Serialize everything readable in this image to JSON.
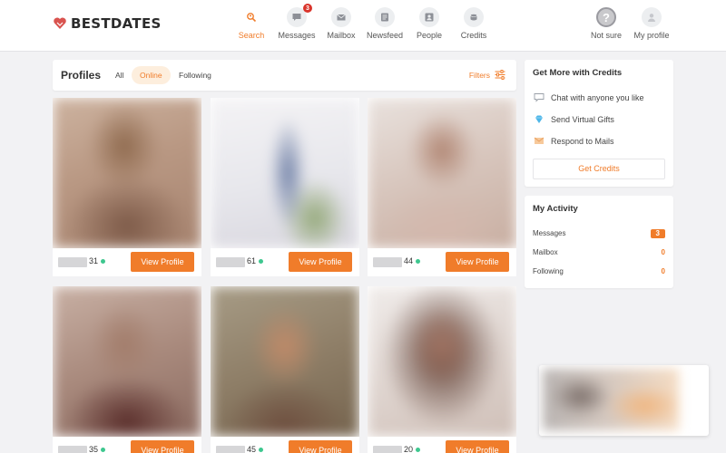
{
  "brand": {
    "name": "BESTDATES"
  },
  "nav": {
    "items": [
      {
        "label": "Search",
        "icon": "search-icon",
        "active": true
      },
      {
        "label": "Messages",
        "icon": "chat-icon",
        "badge": "3"
      },
      {
        "label": "Mailbox",
        "icon": "mail-icon"
      },
      {
        "label": "Newsfeed",
        "icon": "newsfeed-icon"
      },
      {
        "label": "People",
        "icon": "people-icon"
      },
      {
        "label": "Credits",
        "icon": "credits-icon"
      }
    ],
    "not_sure": "Not sure",
    "my_profile": "My profile"
  },
  "profiles": {
    "title": "Profiles",
    "tabs": [
      "All",
      "Online",
      "Following"
    ],
    "active_tab": "Online",
    "filters_label": "Filters",
    "cards": [
      {
        "age": "31",
        "online": true,
        "button": "View Profile"
      },
      {
        "age": "61",
        "online": true,
        "button": "View Profile"
      },
      {
        "age": "44",
        "online": true,
        "button": "View Profile"
      },
      {
        "age": "35",
        "online": true,
        "button": "View Profile"
      },
      {
        "age": "45",
        "online": true,
        "button": "View Profile"
      },
      {
        "age": "20",
        "online": true,
        "button": "View Profile"
      }
    ]
  },
  "credits_panel": {
    "title": "Get More with Credits",
    "items": [
      {
        "label": "Chat with anyone you like",
        "icon": "chat-bubble-icon"
      },
      {
        "label": "Send Virtual Gifts",
        "icon": "gem-icon"
      },
      {
        "label": "Respond to Mails",
        "icon": "envelope-icon"
      }
    ],
    "button": "Get Credits"
  },
  "activity": {
    "title": "My Activity",
    "rows": [
      {
        "label": "Messages",
        "value": "3"
      },
      {
        "label": "Mailbox",
        "value": "0"
      },
      {
        "label": "Following",
        "value": "0"
      }
    ]
  },
  "colors": {
    "accent": "#f07c2a",
    "online": "#3ec78f",
    "badge": "#d9342b",
    "logo": "#d9534f"
  }
}
